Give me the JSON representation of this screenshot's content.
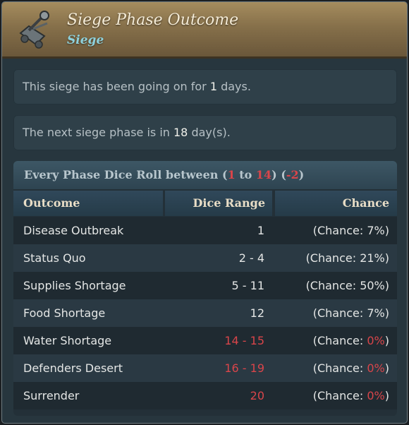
{
  "header": {
    "title": "Siege Phase Outcome",
    "subtitle": "Siege",
    "icon": "catapult-icon"
  },
  "info": {
    "duration_prefix": "This siege has been going on for ",
    "duration_value": "1",
    "duration_suffix": " days.",
    "next_prefix": "The next siege phase is in ",
    "next_value": "18",
    "next_suffix": " day(s)."
  },
  "dice": {
    "label_prefix": "Every Phase Dice Roll between (",
    "min": "1",
    "to": " to ",
    "max": "14",
    "close": ") (",
    "modifier": "-2",
    "end": ")",
    "columns": [
      "Outcome",
      "Dice Range",
      "Chance"
    ],
    "rows": [
      {
        "outcome": "Disease Outbreak",
        "range": "1",
        "range_color": "#e4e6e5",
        "chance_prefix": "(Chance: ",
        "chance": "7%",
        "chance_color": "#e4e6e5",
        "chance_suffix": ")"
      },
      {
        "outcome": "Status Quo",
        "range": "2 - 4",
        "range_color": "#e4e6e5",
        "chance_prefix": "(Chance: ",
        "chance": "21%",
        "chance_color": "#e4e6e5",
        "chance_suffix": ")"
      },
      {
        "outcome": "Supplies Shortage",
        "range": "5 - 11",
        "range_color": "#e4e6e5",
        "chance_prefix": "(Chance: ",
        "chance": "50%",
        "chance_color": "#e4e6e5",
        "chance_suffix": ")"
      },
      {
        "outcome": "Food Shortage",
        "range": "12",
        "range_color": "#e4e6e5",
        "chance_prefix": "(Chance: ",
        "chance": "7%",
        "chance_color": "#e4e6e5",
        "chance_suffix": ")"
      },
      {
        "outcome": "Water Shortage",
        "range": "14 - 15",
        "range_color": "#d9454a",
        "chance_prefix": "(Chance: ",
        "chance": "0%",
        "chance_color": "#d9454a",
        "chance_suffix": ")"
      },
      {
        "outcome": "Defenders Desert",
        "range": "16 - 19",
        "range_color": "#d9454a",
        "chance_prefix": "(Chance: ",
        "chance": "0%",
        "chance_color": "#d9454a",
        "chance_suffix": ")"
      },
      {
        "outcome": "Surrender",
        "range": "20",
        "range_color": "#d9454a",
        "chance_prefix": "(Chance: ",
        "chance": "0%",
        "chance_color": "#d9454a",
        "chance_suffix": ")"
      }
    ]
  }
}
